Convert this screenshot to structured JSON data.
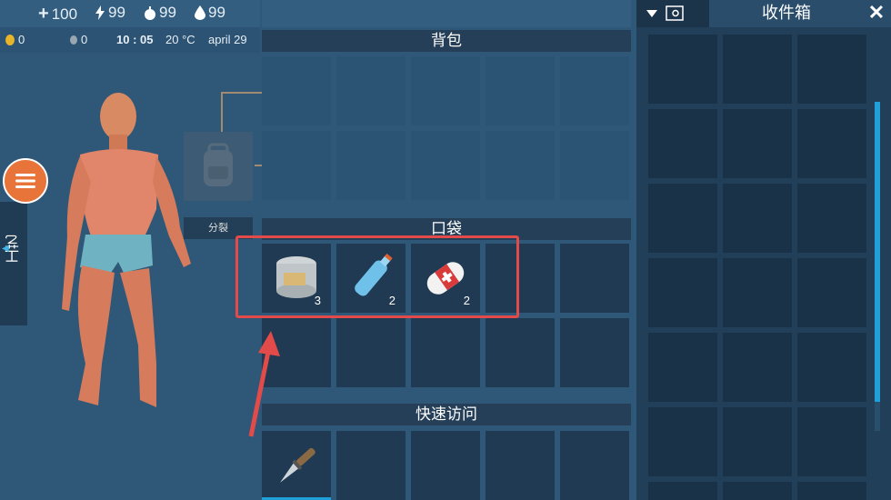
{
  "stats": {
    "health": "100",
    "energy": "99",
    "food": "99",
    "water": "99"
  },
  "status2": {
    "coins": "0",
    "gems": "0",
    "time": "10 : 05",
    "temperature": "20 °C",
    "date": "april 29"
  },
  "sidebar": {
    "craft_label": "工艺"
  },
  "backpack": {
    "title": "背包",
    "split_label": "分裂"
  },
  "pocket": {
    "title": "口袋",
    "items": [
      {
        "name": "canned-food",
        "qty": "3"
      },
      {
        "name": "water-bottle",
        "qty": "2"
      },
      {
        "name": "bandage",
        "qty": "2"
      }
    ]
  },
  "quick_access": {
    "title": "快速访问",
    "items": [
      {
        "name": "knife"
      }
    ]
  },
  "storage": {
    "title": "收件箱",
    "close": "✕"
  },
  "colors": {
    "highlight": "#e34a4a",
    "accent": "#1fa0d8",
    "menu": "#e8743a"
  }
}
